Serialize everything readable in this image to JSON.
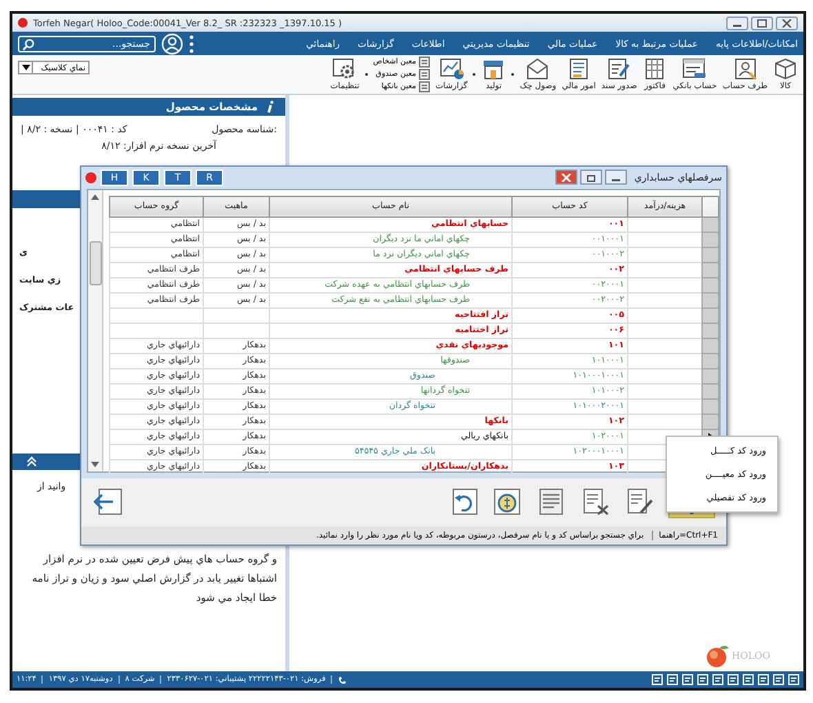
{
  "window": {
    "title": "Torfeh Negar( Holoo_Code:00041_Ver 8.2_ SR :232323 _1397.10.15 )"
  },
  "menu": [
    "امکانات/اطلاعات پايه",
    "عمليات مرتبط به کالا",
    "عمليات مالي",
    "تنظيمات مديريتي",
    "اطلاعات",
    "گزارشات",
    "راهنمائي"
  ],
  "search": {
    "placeholder": "جستجو..."
  },
  "toolbar": [
    {
      "kind": "button",
      "label": "کالا"
    },
    {
      "kind": "button",
      "label": "طرف حساب"
    },
    {
      "kind": "button",
      "label": "حساب بانکي"
    },
    {
      "kind": "button",
      "label": "فاکتور"
    },
    {
      "kind": "button",
      "label": "صدور سند"
    },
    {
      "kind": "button",
      "label": "امور مالي"
    },
    {
      "kind": "button",
      "label": "وصول چک"
    },
    {
      "kind": "separator"
    },
    {
      "kind": "button",
      "label": "توليد"
    },
    {
      "kind": "separator"
    },
    {
      "kind": "button",
      "label": "گزارشات"
    },
    {
      "kind": "stack",
      "items": [
        "معين اشخاص",
        "معين صندوق",
        "معين بانکها"
      ]
    },
    {
      "kind": "separator"
    },
    {
      "kind": "button",
      "label": "تنظيمات"
    }
  ],
  "view_select": {
    "value": "نماي کلاسيک"
  },
  "side_panel": {
    "title": "مشخصات محصول",
    "product_id_label": "شناسه محصول:",
    "product_info": "| کد : ۰۰۰۴۱ | نسخه : ۸/۲",
    "latest_version": "آخرين نسخه نرم افزار: ۸/۱۲",
    "partial_items": [
      "ی",
      "زي سايت",
      "عات مشترک"
    ],
    "note_fragment": "وانيد از",
    "note": "و گروه حساب هاي پيش فرض تعيين شده در نرم افزار اشتباها تغيير يابد در گزارش اصلي سود و زيان و تراز نامه خطا ايجاد مي شود"
  },
  "dialog": {
    "title": "سرفصلهاي حسابداري",
    "quick_buttons": [
      "R",
      "T",
      "K",
      "H"
    ],
    "columns": [
      "هزينه/درآمد",
      "کد حساب",
      "نام حساب",
      "ماهيت",
      "گروه حساب"
    ],
    "rows": [
      {
        "kind": "kol",
        "code": "۰۰۱",
        "name": "حسابهاي انتظامي",
        "nature": "بد / بس",
        "group": "انتظامي",
        "selected": false
      },
      {
        "kind": "moein",
        "code": "۰۰۱۰۰۰۱",
        "name": "چکهاي اماني ما نزد ديگران",
        "nature": "بد / بس",
        "group": "انتظامي",
        "selected": false
      },
      {
        "kind": "moein",
        "code": "۰۰۱۰۰۰۲",
        "name": "چکهاي اماني ديگران نزد ما",
        "nature": "بد / بس",
        "group": "انتظامي",
        "selected": false
      },
      {
        "kind": "kol",
        "code": "۰۰۲",
        "name": "طرف حسابهاي انتظامي",
        "nature": "بد / بس",
        "group": "طرف انتظامي",
        "selected": false
      },
      {
        "kind": "moein",
        "code": "۰۰۲۰۰۰۱",
        "name": "طرف حسابهاي انتظامي به عهده شرکت",
        "nature": "بد / بس",
        "group": "طرف انتظامي",
        "selected": false
      },
      {
        "kind": "moein",
        "code": "۰۰۲۰۰۰۲",
        "name": "طرف حسابهاي انتظامي به نفع شرکت",
        "nature": "بد / بس",
        "group": "طرف انتظامي",
        "selected": false
      },
      {
        "kind": "kol",
        "code": "۰۰۵",
        "name": "تراز افتتاحيه",
        "selected": false
      },
      {
        "kind": "kol",
        "code": "۰۰۶",
        "name": "تراز اختتاميه",
        "selected": false
      },
      {
        "kind": "kol",
        "code": "۱۰۱",
        "name": "موجوديهاي نقدي",
        "nature": "بدهکار",
        "group": "دارائيهاي جاري",
        "selected": false
      },
      {
        "kind": "moein",
        "code": "۱۰۱۰۰۰۱",
        "name": "صندوقها",
        "nature": "بدهکار",
        "group": "دارائيهاي جاري",
        "selected": false
      },
      {
        "kind": "tafsili",
        "code": "۱۰۱۰۰۰۱۰۰۰۱",
        "name": "صندوق",
        "nature": "بدهکار",
        "group": "دارائيهاي جاري",
        "selected": false
      },
      {
        "kind": "moein",
        "code": "۱۰۱۰۰۰۲",
        "name": "تنخواه گردانها",
        "nature": "بدهکار",
        "group": "دارائيهاي جاري",
        "selected": false
      },
      {
        "kind": "tafsili",
        "code": "۱۰۱۰۰۰۲۰۰۰۱",
        "name": "تنخواه گردان",
        "nature": "بدهکار",
        "group": "دارائيهاي جاري",
        "selected": false
      },
      {
        "kind": "kol",
        "code": "۱۰۲",
        "name": "بانکها",
        "nature": "بدهکار",
        "group": "دارائيهاي جاري",
        "selected": false
      },
      {
        "kind": "moein",
        "code": "۱۰۲۰۰۰۱",
        "name": "بانکهاي ريالي",
        "nature": "بدهکار",
        "group": "دارائيهاي جاري",
        "selected": true
      },
      {
        "kind": "tafsili",
        "code": "۱۰۲۰۰۰۱۰۰۰۱",
        "name": "بانک ملي جاري ۵۴۵۴۵",
        "nature": "بدهکار",
        "group": "دارائيهاي جاري",
        "selected": false
      },
      {
        "kind": "kol",
        "code": "۱۰۳",
        "name": "بدهکاران/بستانکاران",
        "nature": "بدهکار",
        "group": "دارائيهاي جاري",
        "selected": false
      }
    ],
    "hint_key": "راهنما=Ctrl+F1",
    "hint": "براي جستجو براساس کد و يا نام سرفصل، درستون مربوطه، کد ويا نام مورد نظر را وارد نمائيد."
  },
  "popup_menu": [
    "ورود کد کـــــل",
    "ورود کد معيــــن",
    "ورود کد تفصيلي"
  ],
  "logo_text": "HOLOO",
  "status_bar": {
    "phones": "فروش: ۰۲۱-۲۲۲۲۲۱۴۳ پشتيباني: ۰۲۱-۲۳۳۰۶۲۷",
    "company": "شرکت ۸",
    "date": "دوشنبه۱۷ دي ۱۳۹۷",
    "time": "۱۱:۲۴"
  }
}
